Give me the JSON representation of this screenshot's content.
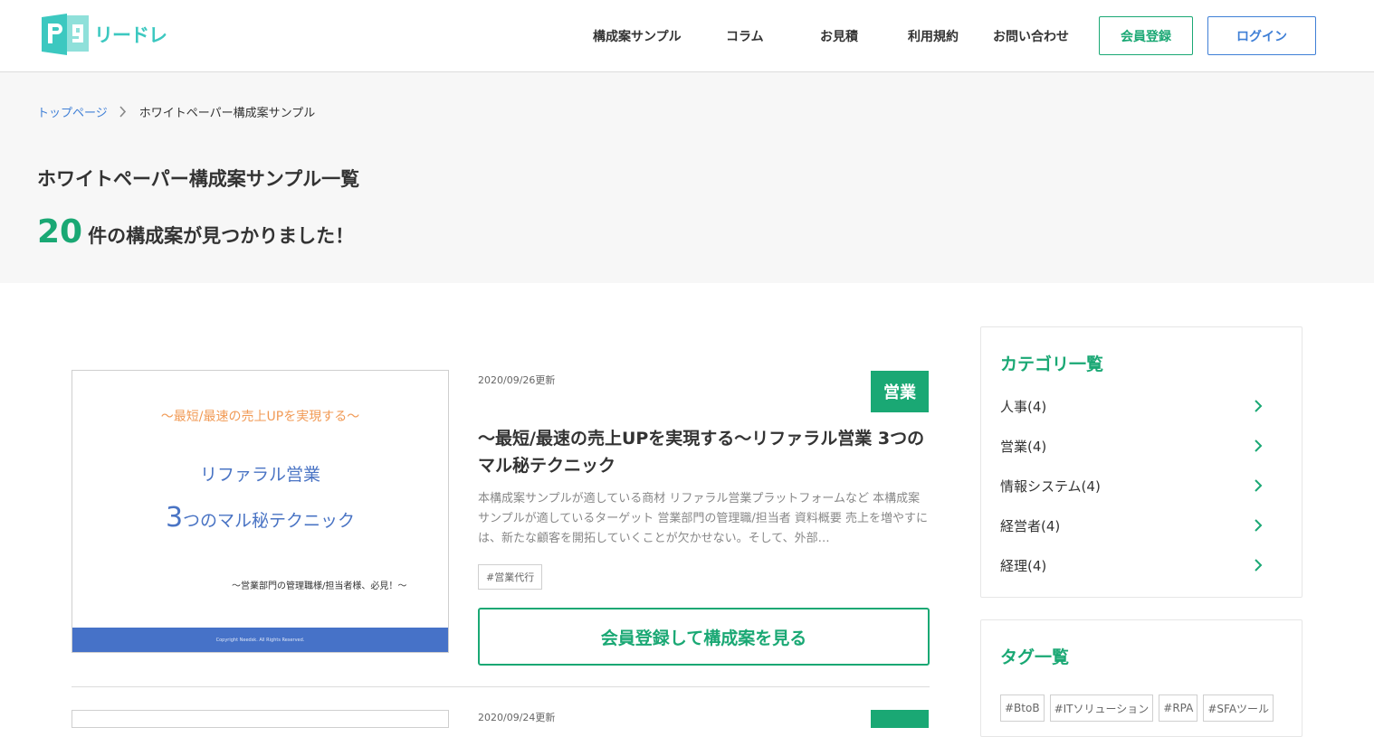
{
  "header": {
    "logo_text": "リードレ",
    "nav": [
      {
        "label": "構成案サンプル"
      },
      {
        "label": "コラム"
      },
      {
        "label": "お見積"
      },
      {
        "label": "利用規約"
      },
      {
        "label": "お問い合わせ"
      }
    ],
    "register_label": "会員登録",
    "login_label": "ログイン"
  },
  "breadcrumb": {
    "home": "トップページ",
    "current": "ホワイトペーパー構成案サンプル"
  },
  "page": {
    "title": "ホワイトペーパー構成案サンプル一覧",
    "result_count": "20",
    "result_text": "件の構成案が見つかりました！"
  },
  "article": {
    "thumbnail": {
      "subtitle": "〜最短/最速の売上UPを実現する〜",
      "title_line1": "リファラル営業",
      "title_num": "3",
      "title_line2_rest": "つのマル秘テクニック",
      "target": "〜営業部門の管理職様/担当者様、必見！〜",
      "copyright": "Copyright Needsk. All Rights Reserved."
    },
    "date": "2020/09/26更新",
    "badge": "営業",
    "title": "〜最短/最速の売上UPを実現する〜リファラル営業 3つのマル秘テクニック",
    "description": "本構成案サンプルが適している商材 リファラル営業プラットフォームなど 本構成案サンプルが適しているターゲット 営業部門の管理職/担当者 資料概要 売上を増やすには、新たな顧客を開拓していくことが欠かせない。そして、外部…",
    "tag": "#営業代行",
    "cta": "会員登録して構成案を見る"
  },
  "article2": {
    "date": "2020/09/24更新"
  },
  "sidebar": {
    "category_heading": "カテゴリ一覧",
    "categories": [
      {
        "label": "人事(4)"
      },
      {
        "label": "営業(4)"
      },
      {
        "label": "情報システム(4)"
      },
      {
        "label": "経営者(4)"
      },
      {
        "label": "経理(4)"
      }
    ],
    "tag_heading": "タグ一覧",
    "tags": [
      {
        "label": "#BtoB"
      },
      {
        "label": "#ITソリューション"
      },
      {
        "label": "#RPA"
      },
      {
        "label": "#SFAツール"
      }
    ]
  },
  "colors": {
    "accent_green": "#1aa874",
    "link_blue": "#3f7fd6",
    "logo_teal": "#3cc8c0"
  }
}
